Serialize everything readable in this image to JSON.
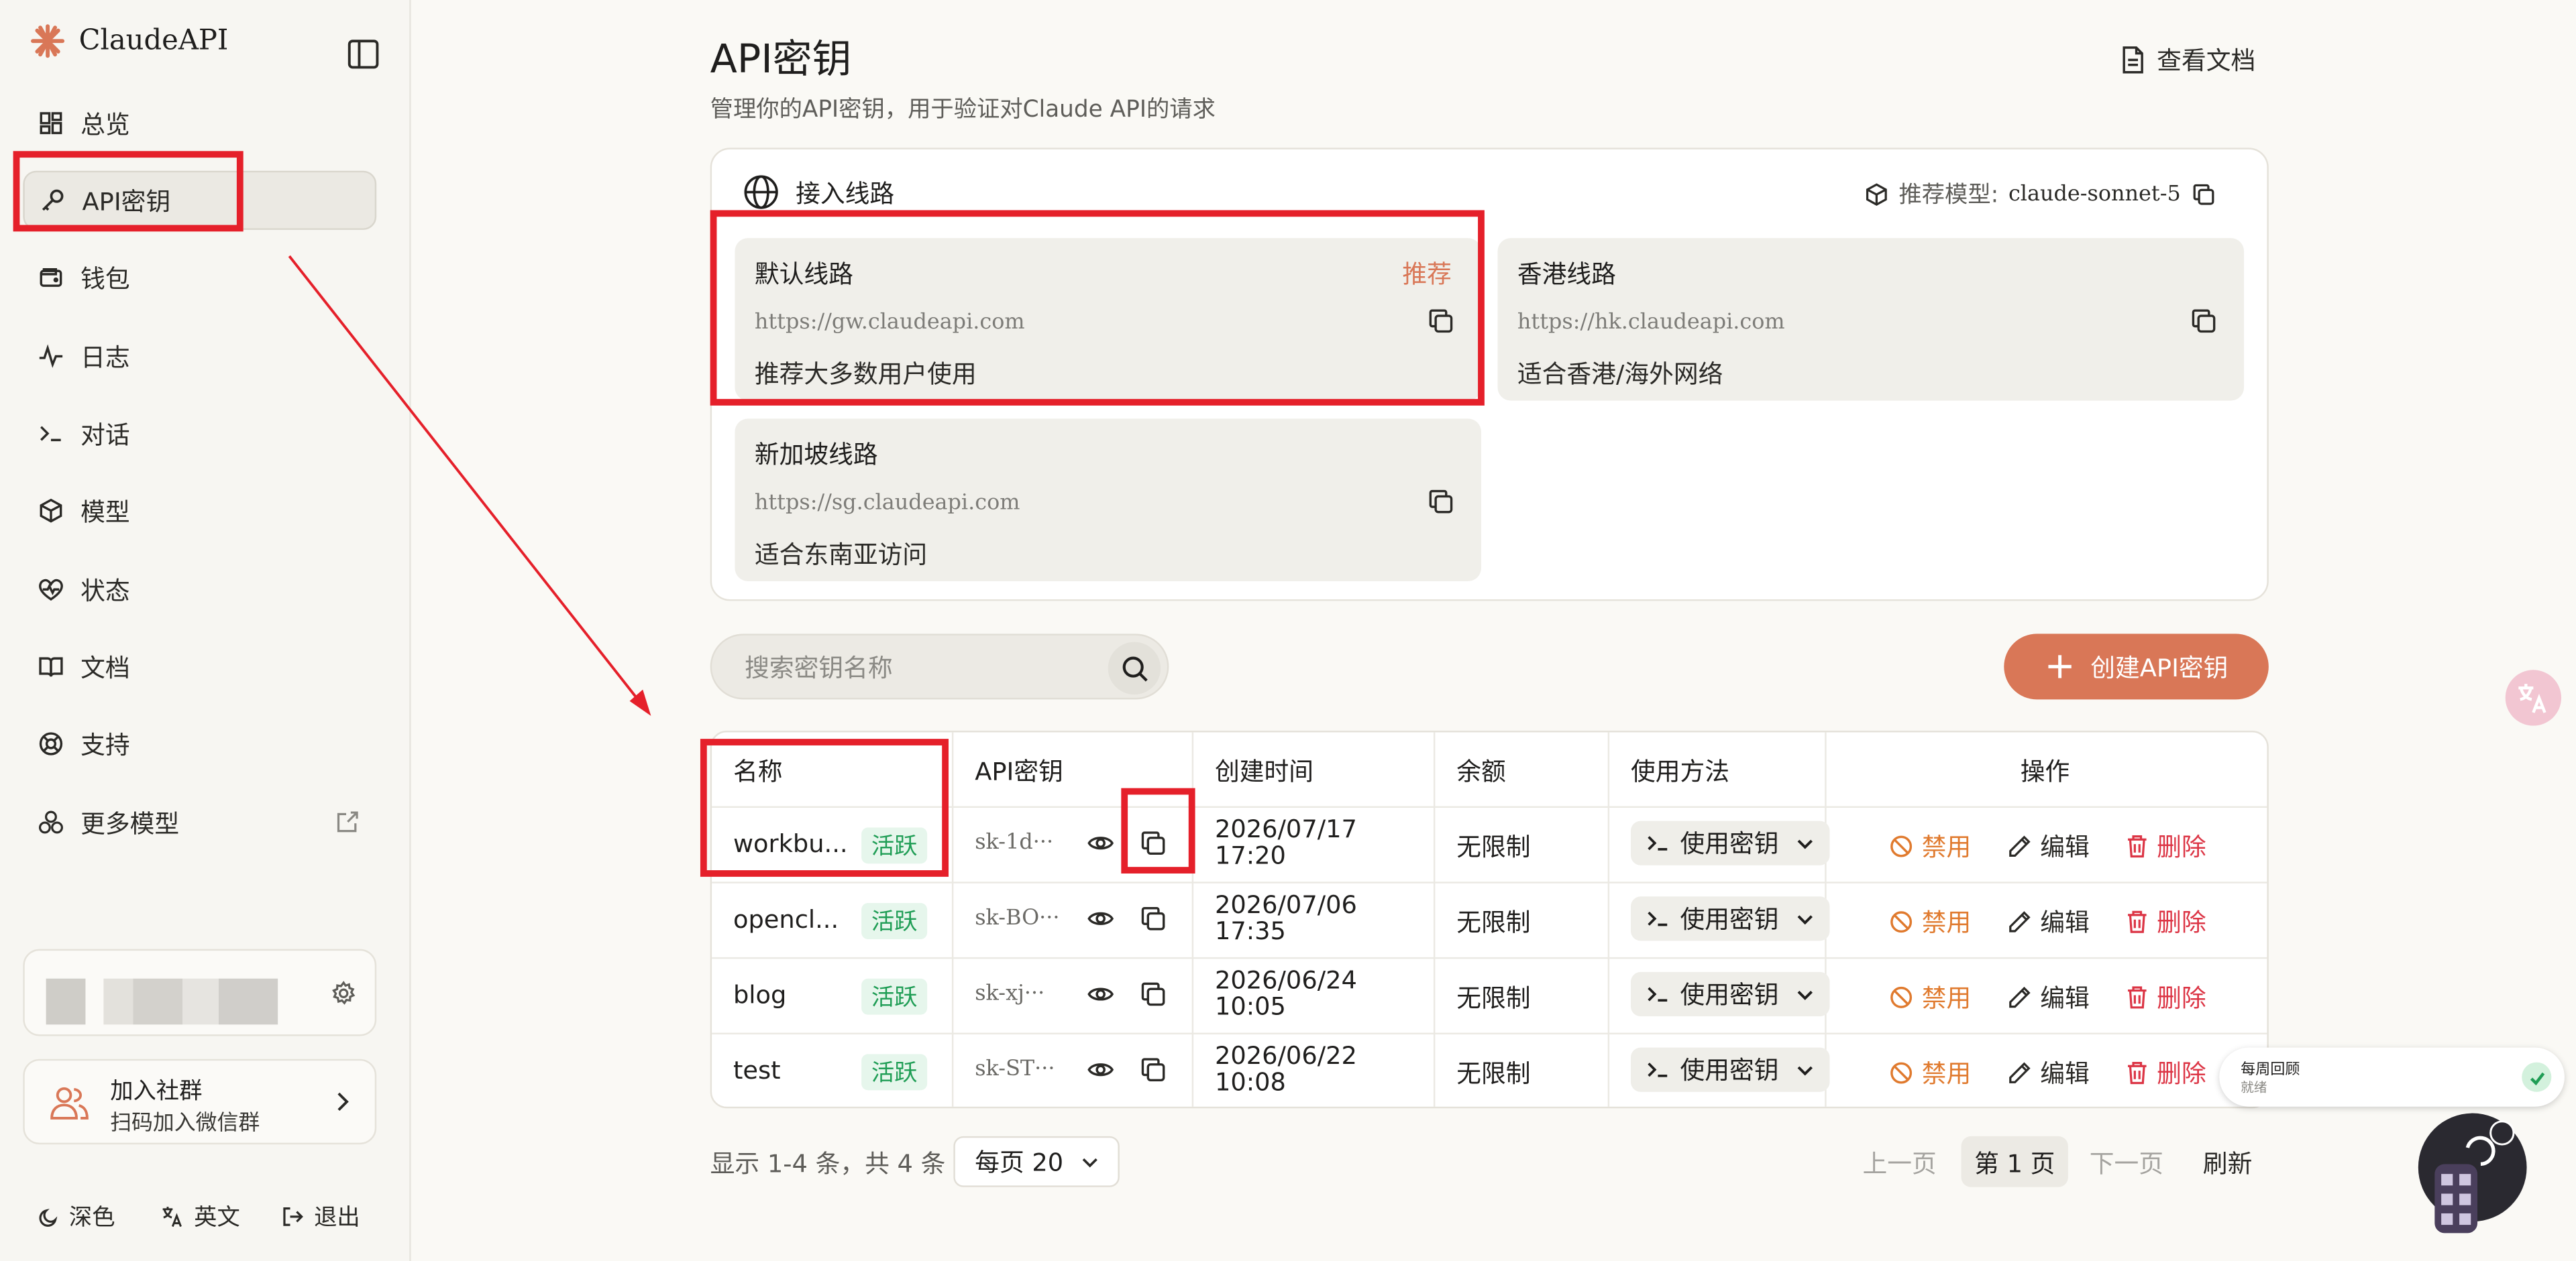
{
  "app": {
    "brand": "ClaudeAPI"
  },
  "sidebar": {
    "items": [
      {
        "label": "总览",
        "icon": "dashboard-grid-icon"
      },
      {
        "label": "API密钥",
        "icon": "key-icon",
        "active": true
      },
      {
        "label": "钱包",
        "icon": "wallet-icon"
      },
      {
        "label": "日志",
        "icon": "activity-icon"
      },
      {
        "label": "对话",
        "icon": "terminal-icon"
      },
      {
        "label": "模型",
        "icon": "cube-icon"
      },
      {
        "label": "状态",
        "icon": "heart-pulse-icon"
      },
      {
        "label": "文档",
        "icon": "book-icon"
      },
      {
        "label": "支持",
        "icon": "lifebuoy-icon"
      },
      {
        "label": "更多模型",
        "icon": "boxes-icon"
      }
    ],
    "community": {
      "title": "加入社群",
      "subtitle": "扫码加入微信群"
    },
    "footer": {
      "theme": "深色",
      "language": "英文",
      "logout": "退出"
    }
  },
  "page": {
    "title": "API密钥",
    "subtitle": "管理你的API密钥，用于验证对Claude API的请求",
    "docs_link": "查看文档"
  },
  "routes": {
    "heading": "接入线路",
    "recommended_label": "推荐模型:",
    "recommended_model": "claude-sonnet-5",
    "cards": [
      {
        "name": "默认线路",
        "tag": "推荐",
        "url": "https://gw.claudeapi.com",
        "desc": "推荐大多数用户使用"
      },
      {
        "name": "香港线路",
        "tag": "",
        "url": "https://hk.claudeapi.com",
        "desc": "适合香港/海外网络"
      },
      {
        "name": "新加坡线路",
        "tag": "",
        "url": "https://sg.claudeapi.com",
        "desc": "适合东南亚访问"
      }
    ]
  },
  "search": {
    "placeholder": "搜索密钥名称"
  },
  "create_button": "创建API密钥",
  "table": {
    "headers": [
      "名称",
      "API密钥",
      "创建时间",
      "余额",
      "使用方法",
      "操作"
    ],
    "rows": [
      {
        "name": "workbu...",
        "status": "活跃",
        "key": "sk-1d···",
        "date": "2026/07/17",
        "time": "17:20",
        "balance": "无限制",
        "usage": "使用密钥",
        "disable": "禁用",
        "edit": "编辑",
        "delete": "删除"
      },
      {
        "name": "opencl...",
        "status": "活跃",
        "key": "sk-BO···",
        "date": "2026/07/06",
        "time": "17:35",
        "balance": "无限制",
        "usage": "使用密钥",
        "disable": "禁用",
        "edit": "编辑",
        "delete": "删除"
      },
      {
        "name": "blog",
        "status": "活跃",
        "key": "sk-xj···",
        "date": "2026/06/24",
        "time": "10:05",
        "balance": "无限制",
        "usage": "使用密钥",
        "disable": "禁用",
        "edit": "编辑",
        "delete": "删除"
      },
      {
        "name": "test",
        "status": "活跃",
        "key": "sk-ST···",
        "date": "2026/06/22",
        "time": "10:08",
        "balance": "无限制",
        "usage": "使用密钥",
        "disable": "禁用",
        "edit": "编辑",
        "delete": "删除"
      }
    ]
  },
  "pagination": {
    "info": "显示 1-4 条，共 4 条",
    "page_size": "每页 20",
    "prev": "上一页",
    "current": "第 1 页",
    "next": "下一页",
    "refresh": "刷新"
  },
  "toast": {
    "title": "每周回顾",
    "status": "就绪"
  },
  "colors": {
    "accent": "#d97757",
    "annotation": "#e5202a",
    "active": "#1f9d55",
    "danger": "#dc3545",
    "warning": "#e07a2e"
  }
}
